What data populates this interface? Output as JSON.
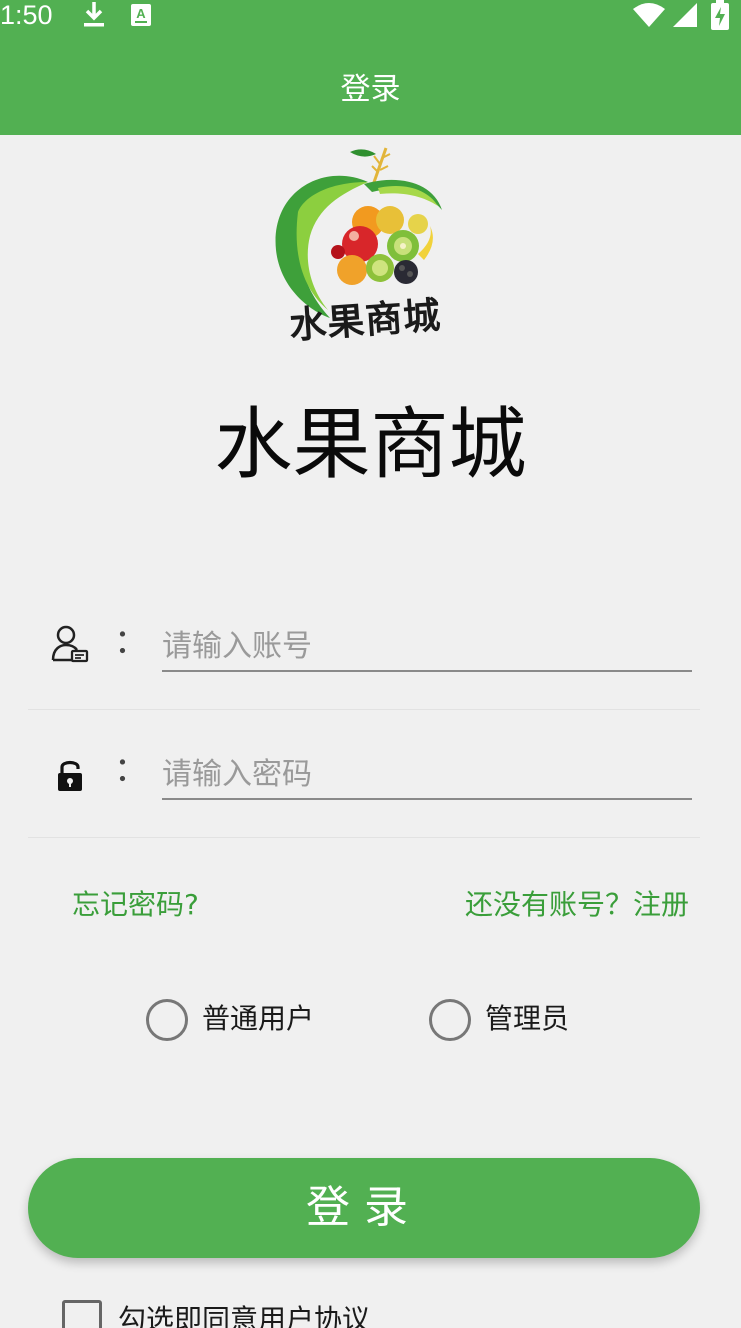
{
  "status_bar": {
    "time": "1:50",
    "icons": [
      "download-icon",
      "keyboard-a-icon",
      "wifi-icon",
      "signal-icon",
      "battery-charging-icon"
    ]
  },
  "app_bar": {
    "title": "登录"
  },
  "logo": {
    "text": "水果商城",
    "accent": "#3ea03a"
  },
  "brand": {
    "title": "水果商城"
  },
  "form": {
    "account": {
      "icon": "user-card-icon",
      "colon": "：",
      "placeholder": "请输入账号",
      "value": ""
    },
    "password": {
      "icon": "lock-icon",
      "colon": "：",
      "placeholder": "请输入密码",
      "value": ""
    }
  },
  "links": {
    "forgot": "忘记密码?",
    "register": "还没有账号？注册"
  },
  "roles": {
    "options": [
      "普通用户",
      "管理员"
    ],
    "selected": null
  },
  "login_button": {
    "label": "登录"
  },
  "agreement": {
    "label": "勾选即同意用户协议",
    "checked": false
  },
  "colors": {
    "primary": "#52b052",
    "link": "#3a9e3a",
    "background": "#f0f0f0"
  }
}
